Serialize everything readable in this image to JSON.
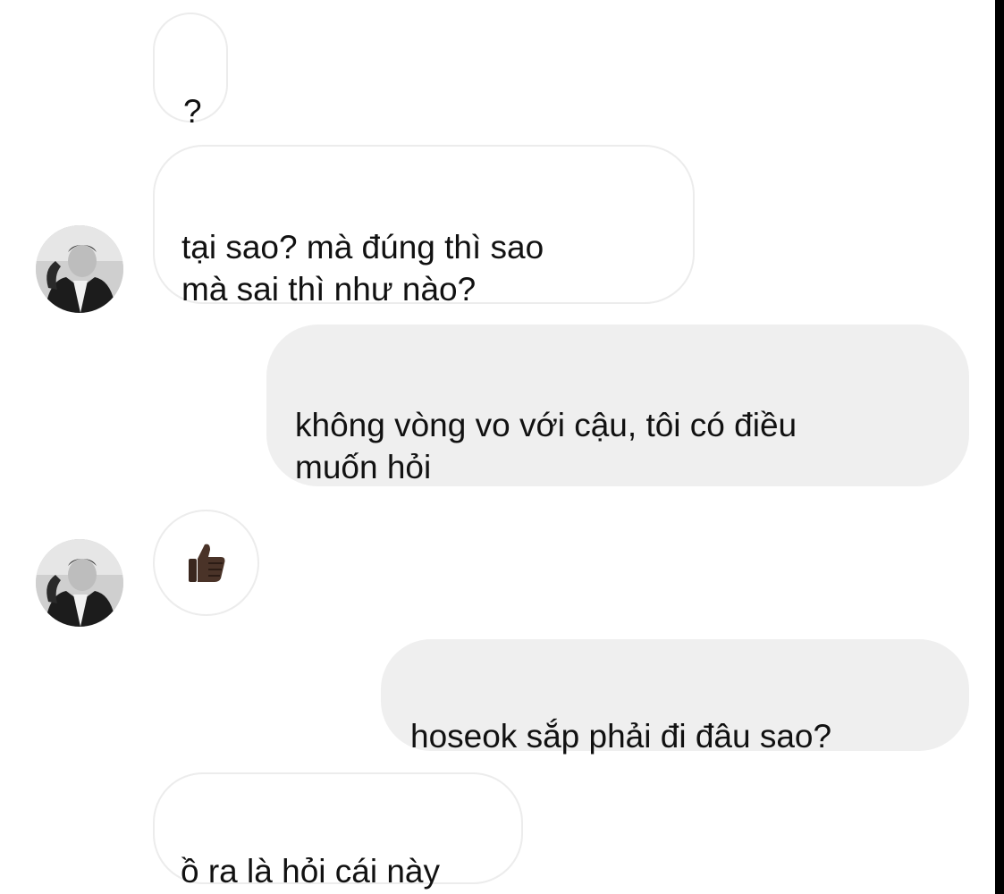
{
  "conversation": {
    "messages": [
      {
        "id": "m1",
        "direction": "incoming",
        "text": "?"
      },
      {
        "id": "m2",
        "direction": "incoming",
        "text": "tại sao? mà đúng thì sao\nmà sai thì như nào?",
        "avatar": "profile-photo"
      },
      {
        "id": "m3",
        "direction": "outgoing",
        "text": "không vòng vo với cậu, tôi có điều\nmuốn hỏi"
      },
      {
        "id": "m4",
        "direction": "incoming",
        "reaction": "thumbs-up-icon",
        "avatar": "profile-photo"
      },
      {
        "id": "m5",
        "direction": "outgoing",
        "text": "hoseok sắp phải đi đâu sao?"
      },
      {
        "id": "m6",
        "direction": "incoming",
        "text": "ồ ra là hỏi cái này"
      }
    ]
  },
  "colors": {
    "incoming_bubble": "#ffffff",
    "incoming_border": "#ececec",
    "outgoing_bubble": "#efefef",
    "text": "#111111",
    "thumbs_up": "#4a3328",
    "edge_bar": "#000000"
  }
}
